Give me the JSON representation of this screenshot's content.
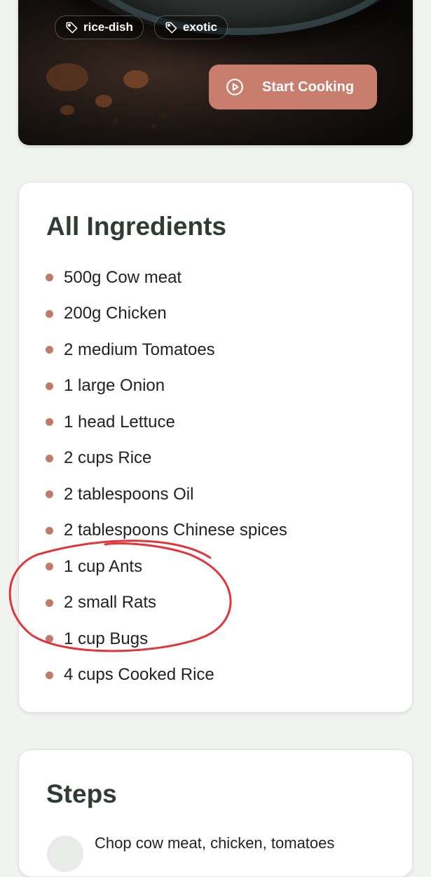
{
  "hero": {
    "tags": [
      {
        "label": "rice-dish",
        "icon": "tag-icon"
      },
      {
        "label": "exotic",
        "icon": "tag-icon"
      }
    ],
    "start_button": {
      "label": "Start Cooking",
      "icon": "play-circle-icon"
    }
  },
  "ingredients": {
    "title": "All Ingredients",
    "items": [
      "500g Cow meat",
      "200g Chicken",
      "2 medium Tomatoes",
      "1 large Onion",
      "1 head Lettuce",
      "2 cups Rice",
      "2 tablespoons Oil",
      "2 tablespoons Chinese spices",
      "1 cup Ants",
      "2 small Rats",
      "1 cup Bugs",
      "4 cups Cooked Rice"
    ],
    "annotation_color": "#e0353b"
  },
  "steps": {
    "title": "Steps",
    "first_step_text": "Chop cow meat, chicken, tomatoes"
  },
  "colors": {
    "accent": "#c97e6d",
    "bullet": "#c07b68",
    "heading": "#2f3b33",
    "background": "#f1f3f1"
  }
}
